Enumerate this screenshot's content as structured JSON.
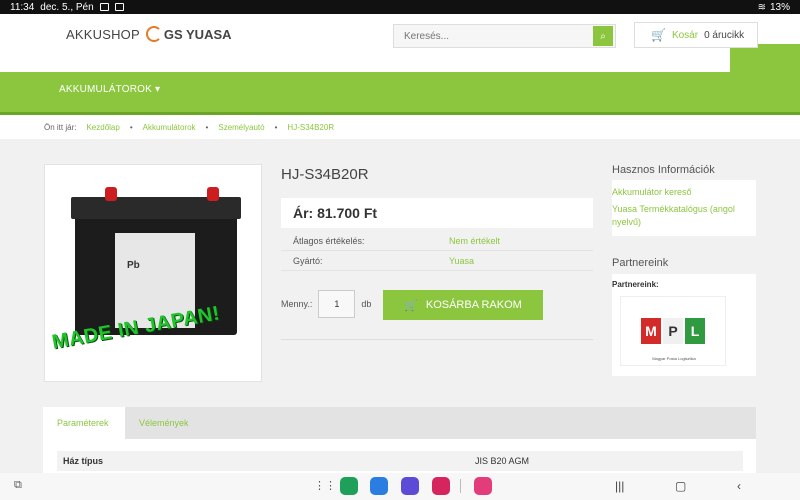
{
  "statusbar": {
    "time": "11:34",
    "date": "dec. 5., Pén",
    "battery": "13%"
  },
  "header": {
    "logo_text": "AKKUSHOP",
    "brand_text": "GS YUASA",
    "search": {
      "placeholder": "Keresés..."
    },
    "cart": {
      "label": "Kosár",
      "count": "0 árucikk"
    }
  },
  "nav": {
    "menu_label": "AKKUMULÁTOROK ▾"
  },
  "breadcrumb": {
    "prefix": "Ön itt jár:",
    "items": [
      "Kezdőlap",
      "Akkumulátorok",
      "Személyautó",
      "HJ-S34B20R"
    ]
  },
  "product": {
    "title": "HJ-S34B20R",
    "price": "Ár: 81.700 Ft",
    "rating_label": "Átlagos értékelés:",
    "rating_value": "Nem értékelt",
    "maker_label": "Gyártó:",
    "maker_value": "Yuasa",
    "qty_label": "Menny.:",
    "qty_value": "1",
    "qty_unit": "db",
    "add_button": "KOSÁRBA RAKOM",
    "image_text": "MADE IN JAPAN!",
    "image_label": "Pb"
  },
  "sidebar": {
    "info_title": "Hasznos Információk",
    "links": [
      "Akkumulátor kereső",
      "Yuasa Termékkatalógus (angol nyelvű)"
    ],
    "partners_title": "Partnereink",
    "partners_label": "Partnereink:",
    "partner_logo_letters": [
      "M",
      "P",
      "L"
    ],
    "partner_logo_caption": "Magyar Posta Logisztika"
  },
  "tabs": {
    "items": [
      "Paraméterek",
      "Vélemények"
    ]
  },
  "params": [
    {
      "key": "Ház típus",
      "value": "JIS B20 AGM"
    }
  ],
  "colors": {
    "accent": "#8cc63f",
    "accent_dark": "#6aa528"
  }
}
